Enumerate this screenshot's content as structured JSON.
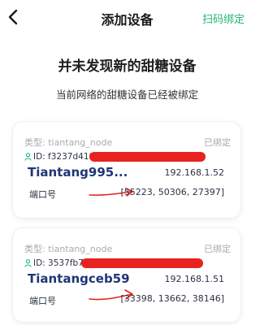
{
  "header": {
    "title": "添加设备",
    "scan_bind_label": "扫码绑定",
    "accent_color": "#22b573"
  },
  "main": {
    "headline": "并未发现新的甜糖设备",
    "subline": "当前网络的甜糖设备已经被绑定"
  },
  "devices": [
    {
      "type_label": "类型: tiantang_node",
      "status": "已绑定",
      "id_text": "ID: f3237d41079a8",
      "name": "Tiantang995...",
      "ip": "192.168.1.52",
      "port_label": "端口号",
      "ports": "[55223, 50306, 27397]"
    },
    {
      "type_label": "类型: tiantang_node",
      "status": "已绑定",
      "id_text": "ID: 3537fb7262ea",
      "name": "Tiantangceb59",
      "ip": "192.168.1.51",
      "port_label": "端口号",
      "ports": "[33398, 13662, 38146]"
    }
  ]
}
